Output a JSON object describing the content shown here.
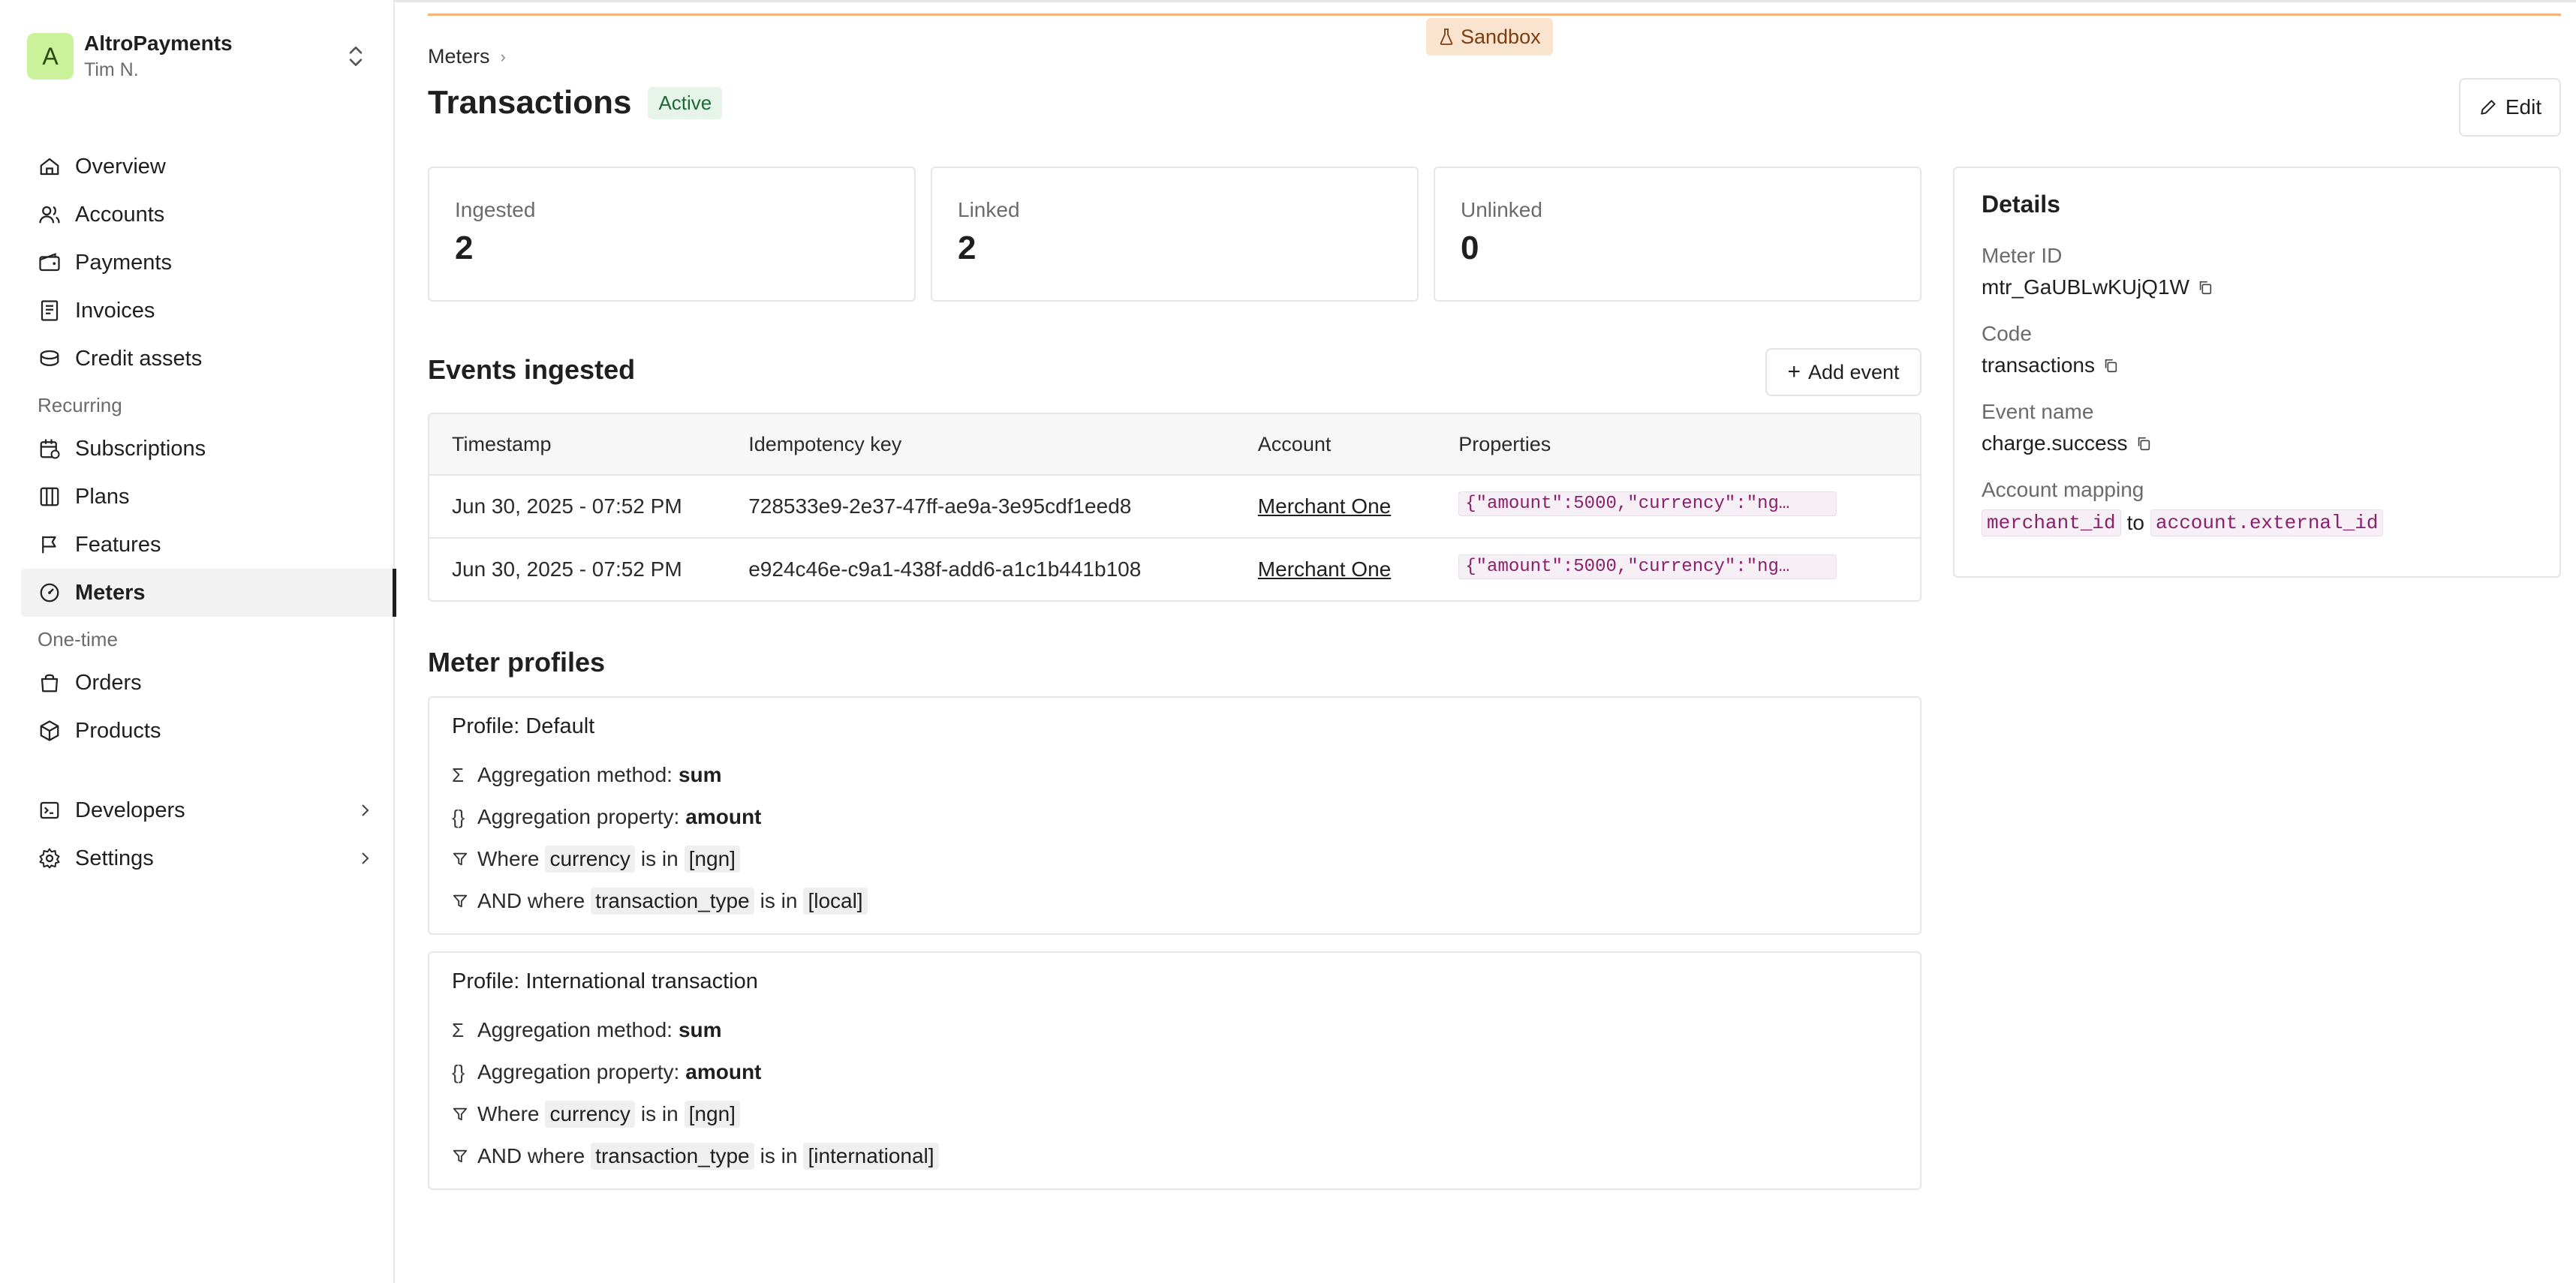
{
  "org": {
    "initial": "A",
    "name": "AltroPayments",
    "user": "Tim N."
  },
  "nav": {
    "main": [
      {
        "label": "Overview",
        "icon": "home-icon"
      },
      {
        "label": "Accounts",
        "icon": "users-icon"
      },
      {
        "label": "Payments",
        "icon": "wallet-icon"
      },
      {
        "label": "Invoices",
        "icon": "invoice-icon"
      },
      {
        "label": "Credit assets",
        "icon": "coins-icon"
      }
    ],
    "recurring_label": "Recurring",
    "recurring": [
      {
        "label": "Subscriptions",
        "icon": "calendar-icon"
      },
      {
        "label": "Plans",
        "icon": "columns-icon"
      },
      {
        "label": "Features",
        "icon": "flag-icon"
      },
      {
        "label": "Meters",
        "icon": "gauge-icon",
        "active": true
      }
    ],
    "onetime_label": "One-time",
    "onetime": [
      {
        "label": "Orders",
        "icon": "bag-icon"
      },
      {
        "label": "Products",
        "icon": "box-icon"
      }
    ],
    "bottom": [
      {
        "label": "Developers",
        "icon": "terminal-icon"
      },
      {
        "label": "Settings",
        "icon": "gear-icon"
      }
    ]
  },
  "sandbox_label": "Sandbox",
  "breadcrumb": {
    "parent": "Meters",
    "sep": "›"
  },
  "page": {
    "title": "Transactions",
    "status": "Active",
    "edit_label": "Edit"
  },
  "stats": [
    {
      "label": "Ingested",
      "value": "2"
    },
    {
      "label": "Linked",
      "value": "2"
    },
    {
      "label": "Unlinked",
      "value": "0"
    }
  ],
  "details": {
    "title": "Details",
    "meter_id_label": "Meter ID",
    "meter_id": "mtr_GaUBLwKUjQ1W",
    "code_label": "Code",
    "code": "transactions",
    "event_name_label": "Event name",
    "event_name": "charge.success",
    "mapping_label": "Account mapping",
    "mapping_from": "merchant_id",
    "mapping_to_word": "to",
    "mapping_to": "account.external_id"
  },
  "events": {
    "title": "Events ingested",
    "add_label": "Add event",
    "columns": [
      "Timestamp",
      "Idempotency key",
      "Account",
      "Properties"
    ],
    "rows": [
      {
        "timestamp": "Jun 30, 2025 - 07:52 PM",
        "key": "728533e9-2e37-47ff-ae9a-3e95cdf1eed8",
        "account": "Merchant One",
        "properties": "{\"amount\":5000,\"currency\":\"ng…"
      },
      {
        "timestamp": "Jun 30, 2025 - 07:52 PM",
        "key": "e924c46e-c9a1-438f-add6-a1c1b441b108",
        "account": "Merchant One",
        "properties": "{\"amount\":5000,\"currency\":\"ng…"
      }
    ]
  },
  "profiles": {
    "title": "Meter profiles",
    "items": [
      {
        "prefix": "Profile:",
        "name": "Default",
        "method_label": "Aggregation method:",
        "method": "sum",
        "property_label": "Aggregation property:",
        "property": "amount",
        "where_label": "Where",
        "where_field": "currency",
        "is_in": "is in",
        "where_value": "[ngn]",
        "and_label": "AND where",
        "and_field": "transaction_type",
        "and_value": "[local]"
      },
      {
        "prefix": "Profile:",
        "name": "International transaction",
        "method_label": "Aggregation method:",
        "method": "sum",
        "property_label": "Aggregation property:",
        "property": "amount",
        "where_label": "Where",
        "where_field": "currency",
        "is_in": "is in",
        "where_value": "[ngn]",
        "and_label": "AND where",
        "and_field": "transaction_type",
        "and_value": "[international]"
      }
    ]
  }
}
